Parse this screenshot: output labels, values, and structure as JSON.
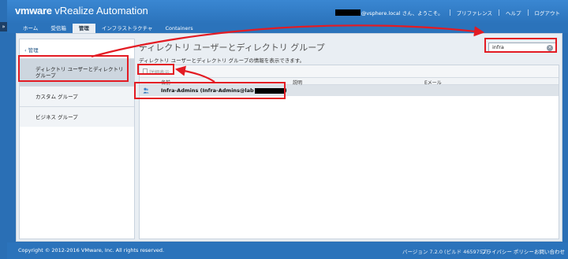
{
  "header": {
    "brand_vm": "vm",
    "brand_ware": "ware",
    "brand_product": "vRealize Automation",
    "user_suffix": "@vsphere.local さん、ようこそ。",
    "links": [
      "プリファレンス",
      "ヘルプ",
      "ログアウト"
    ]
  },
  "tabs": [
    {
      "label": "ホーム"
    },
    {
      "label": "受信箱"
    },
    {
      "label": "管理",
      "active": true
    },
    {
      "label": "インフラストラクチャ"
    },
    {
      "label": "Containers"
    }
  ],
  "sidebar": {
    "back_label": "管理",
    "items": [
      {
        "label_line1": "ディレクトリ ユーザーとディレクトリ",
        "label_line2": "グループ",
        "selected": true
      },
      {
        "label": "カスタム グループ"
      },
      {
        "label": "ビジネス グループ"
      }
    ]
  },
  "main": {
    "title": "ディレクトリ ユーザーとディレクトリ グループ",
    "description": "ディレクトリ ユーザーとディレクトリ グループの情報を表示できます。",
    "search_value": "infra",
    "toolbar": {
      "details_label": "詳細表示"
    },
    "columns": [
      "名前",
      "説明",
      "Eメール"
    ],
    "rows": [
      {
        "name_prefix": "Infra-Admins (Infra-Admins@lab",
        "name_suffix": ")"
      }
    ]
  },
  "footer": {
    "copyright": "Copyright © 2012-2016 VMware, Inc. All rights reserved.",
    "version": "バージョン 7.2.0 (ビルド 4659752)",
    "privacy": "プライバシー ポリシー",
    "contact": "お問い合わせ"
  },
  "colors": {
    "header_blue": "#2b73bb",
    "annotation_red": "#e31b23",
    "selected_row": "#dde3e9"
  }
}
